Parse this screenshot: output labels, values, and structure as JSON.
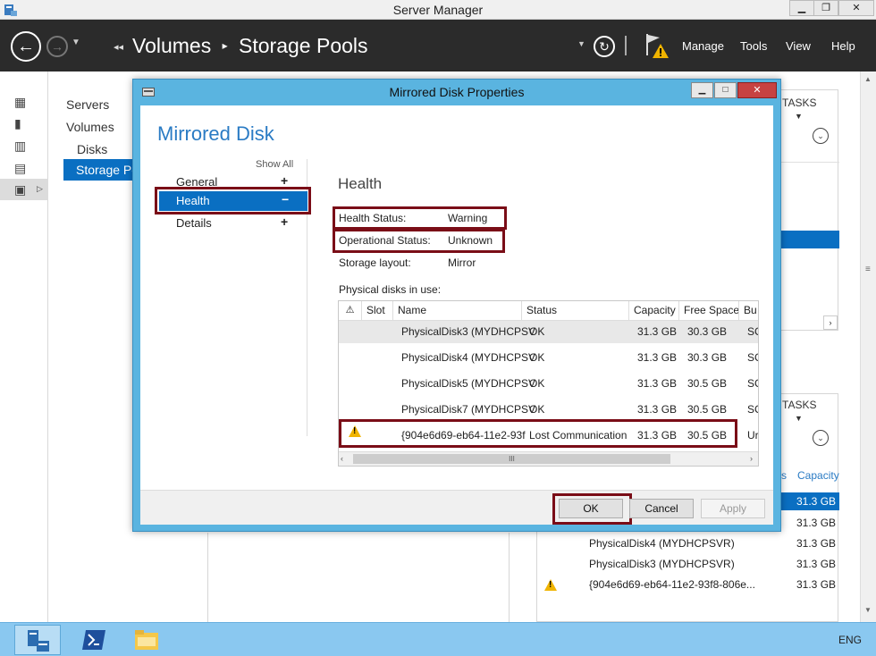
{
  "window": {
    "title": "Server Manager"
  },
  "header": {
    "breadcrumb": [
      "Volumes",
      "Storage Pools"
    ],
    "menu": [
      "Manage",
      "Tools",
      "View",
      "Help"
    ]
  },
  "nav": {
    "items": [
      "Servers",
      "Volumes",
      "Disks",
      "Storage Po"
    ]
  },
  "background": {
    "tasks_label": "TASKS",
    "tasks_label2": "TASKS",
    "col_s": "s",
    "col_capacity": "Capacity",
    "rows": [
      {
        "name": "",
        "capacity": "31.3 GB"
      },
      {
        "name": "",
        "capacity": "31.3 GB"
      },
      {
        "name": "PhysicalDisk4 (MYDHCPSVR)",
        "capacity": "31.3 GB"
      },
      {
        "name": "PhysicalDisk3 (MYDHCPSVR)",
        "capacity": "31.3 GB"
      },
      {
        "name": "{904e6d69-eb64-11e2-93f8-806e...",
        "capacity": "31.3 GB"
      }
    ]
  },
  "dialog": {
    "title": "Mirrored Disk Properties",
    "heading": "Mirrored Disk",
    "show_all": "Show All",
    "sections": [
      {
        "label": "General",
        "toggle": "+"
      },
      {
        "label": "Health",
        "toggle": "−"
      },
      {
        "label": "Details",
        "toggle": "+"
      }
    ],
    "section_title": "Health",
    "props": [
      {
        "label": "Health Status:",
        "value": "Warning"
      },
      {
        "label": "Operational Status:",
        "value": "Unknown"
      },
      {
        "label": "Storage layout:",
        "value": "Mirror"
      }
    ],
    "disks_label": "Physical disks in use:",
    "columns": [
      "⚠",
      "Slot",
      "Name",
      "Status",
      "Capacity",
      "Free Space",
      "Bu"
    ],
    "disks": [
      {
        "warn": false,
        "slot": "",
        "name": "PhysicalDisk3 (MYDHCPSV",
        "status": "OK",
        "capacity": "31.3 GB",
        "free": "30.3 GB",
        "bus": "SC"
      },
      {
        "warn": false,
        "slot": "",
        "name": "PhysicalDisk4 (MYDHCPSV",
        "status": "OK",
        "capacity": "31.3 GB",
        "free": "30.3 GB",
        "bus": "SC"
      },
      {
        "warn": false,
        "slot": "",
        "name": "PhysicalDisk5 (MYDHCPSV",
        "status": "OK",
        "capacity": "31.3 GB",
        "free": "30.5 GB",
        "bus": "SC"
      },
      {
        "warn": false,
        "slot": "",
        "name": "PhysicalDisk7 (MYDHCPSV",
        "status": "OK",
        "capacity": "31.3 GB",
        "free": "30.5 GB",
        "bus": "SC"
      },
      {
        "warn": true,
        "slot": "",
        "name": "{904e6d69-eb64-11e2-93f",
        "status": "Lost Communication",
        "capacity": "31.3 GB",
        "free": "30.5 GB",
        "bus": "Ur"
      }
    ],
    "hscroll_thumb": "III",
    "buttons": {
      "ok": "OK",
      "cancel": "Cancel",
      "apply": "Apply"
    }
  },
  "taskbar": {
    "lang": "ENG"
  },
  "colors": {
    "dialog_border": "#5ab4e0",
    "selected": "#0a6fc2",
    "highlight": "#7a0d17",
    "header": "#2b2b2b",
    "taskbar": "#8ac8f0"
  }
}
